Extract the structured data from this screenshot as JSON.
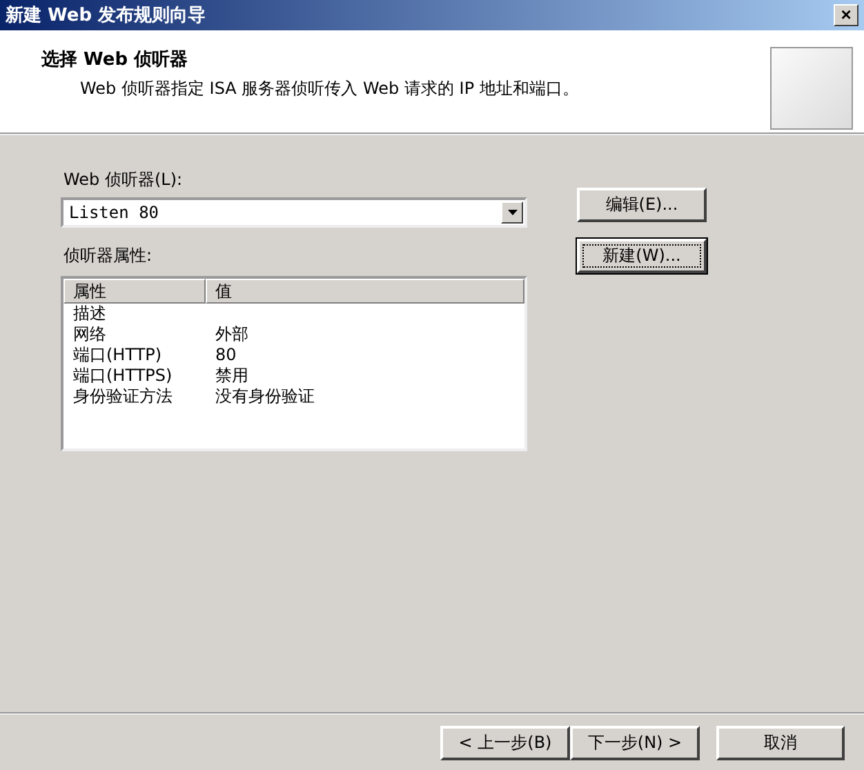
{
  "window": {
    "title": "新建 Web 发布规则向导",
    "close": "×"
  },
  "header": {
    "title": "选择 Web 侦听器",
    "description": "Web 侦听器指定 ISA 服务器侦听传入 Web 请求的 IP 地址和端口。"
  },
  "listener": {
    "label": "Web 侦听器(L):",
    "value": "Listen 80"
  },
  "side_buttons": [
    {
      "label": "编辑(E)...",
      "focused": false
    },
    {
      "label": "新建(W)...",
      "focused": true
    }
  ],
  "properties": {
    "label": "侦听器属性:",
    "columns": [
      "属性",
      "值"
    ],
    "rows": [
      [
        "描述",
        ""
      ],
      [
        "网络",
        "外部"
      ],
      [
        "端口(HTTP)",
        "80"
      ],
      [
        "端口(HTTPS)",
        "禁用"
      ],
      [
        "身份验证方法",
        "没有身份验证"
      ]
    ]
  },
  "footer_buttons": [
    "< 上一步(B)",
    "下一步(N) >",
    "取消"
  ]
}
